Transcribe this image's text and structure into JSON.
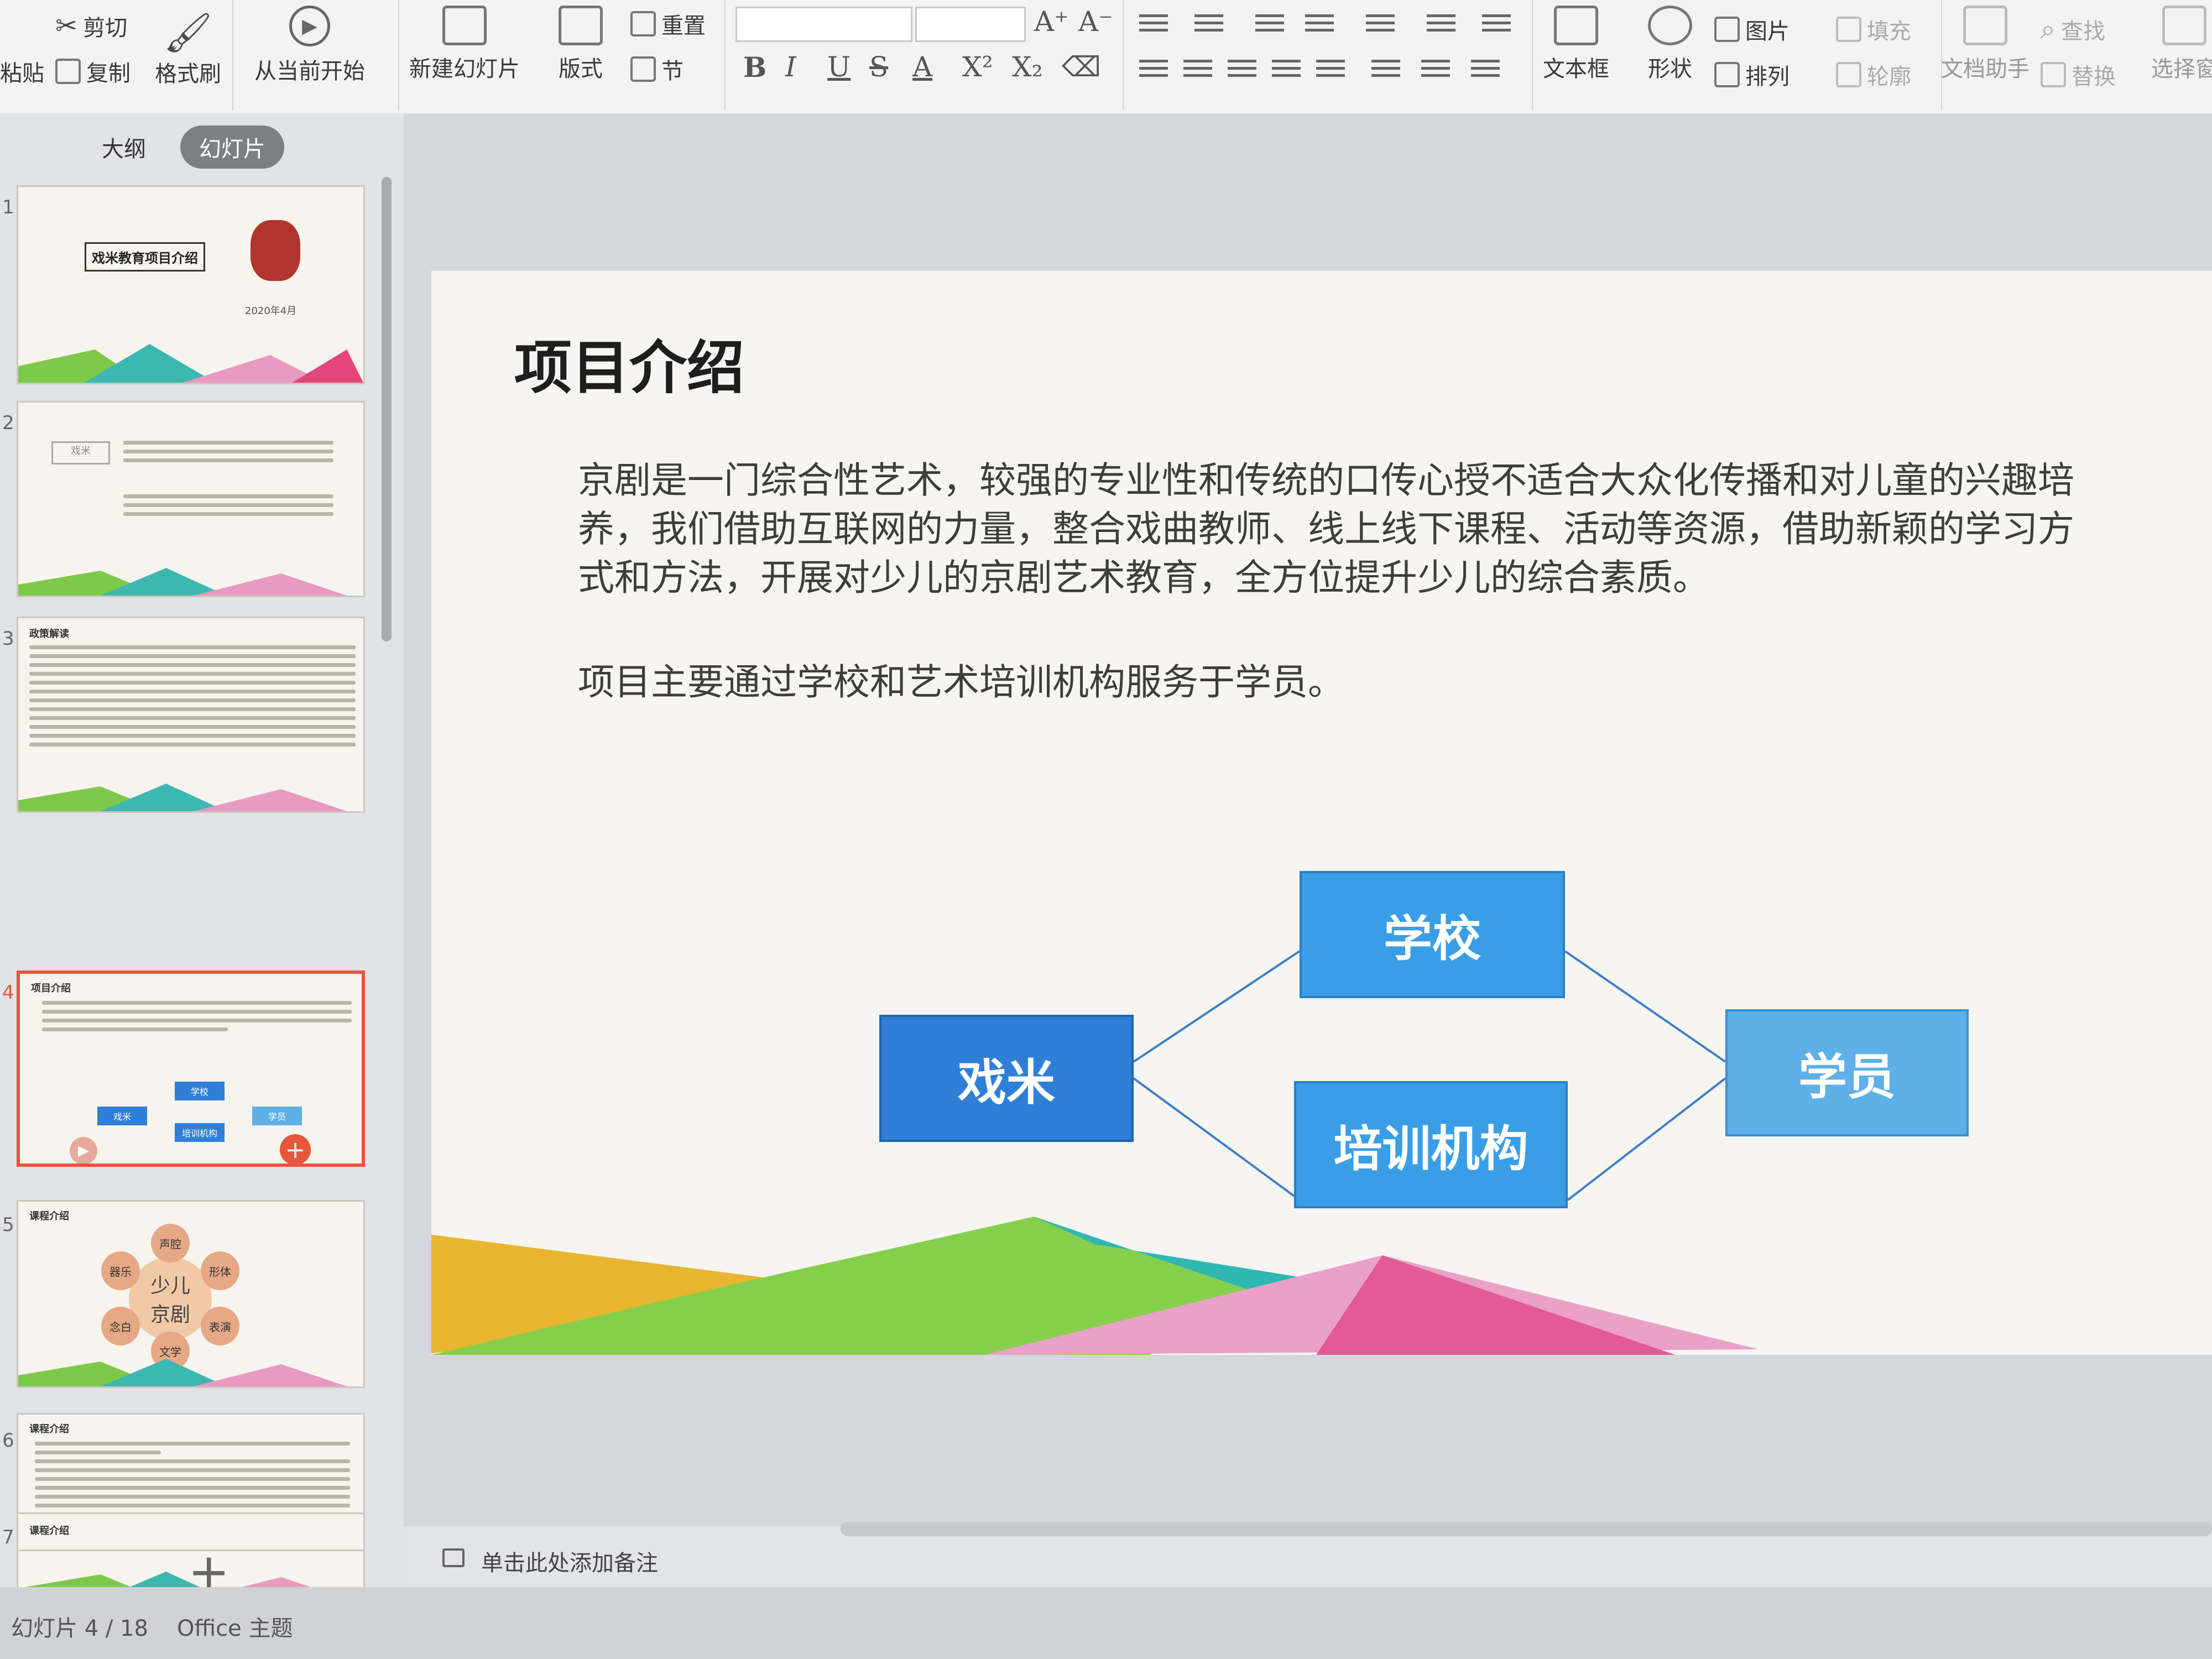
{
  "ribbon": {
    "clipboard": {
      "paste": "粘贴",
      "cut": "剪切",
      "copy": "复制",
      "format_painter": "格式刷"
    },
    "slideshow": {
      "from_current": "从当前开始"
    },
    "slides": {
      "new_slide": "新建幻灯片",
      "layout": "版式",
      "reset": "重置",
      "section": "节"
    },
    "font": {
      "bold": "B",
      "italic": "I",
      "underline": "U",
      "strike": "S",
      "color": "A",
      "superscript": "X²",
      "subscript": "X₂",
      "grow": "A⁺",
      "shrink": "A⁻"
    },
    "drawing": {
      "textbox": "文本框",
      "shape": "形状",
      "picture": "图片",
      "arrange": "排列",
      "fill": "填充",
      "outline": "轮廓"
    },
    "tools": {
      "doc_assistant": "文档助手",
      "find": "查找",
      "replace": "替换",
      "select": "选择窗"
    }
  },
  "left_panel": {
    "tab_outline": "大纲",
    "tab_slides": "幻灯片",
    "thumbs": [
      {
        "num": "1",
        "title": "戏米教育项目介绍",
        "date": "2020年4月"
      },
      {
        "num": "2",
        "title": "戏米"
      },
      {
        "num": "3",
        "title": "政策解读"
      },
      {
        "num": "4",
        "title": "项目介绍",
        "b1": "学校",
        "b2": "戏米",
        "b3": "培训机构",
        "b4": "学员"
      },
      {
        "num": "5",
        "title": "课程介绍",
        "center1": "少儿",
        "center2": "京剧",
        "p1": "声腔",
        "p2": "形体",
        "p3": "表演",
        "p4": "文学",
        "p5": "念白",
        "p6": "器乐"
      },
      {
        "num": "6",
        "title": "课程介绍"
      },
      {
        "num": "7",
        "title": "课程介绍"
      }
    ]
  },
  "slide": {
    "title": "项目介绍",
    "para1_line1": "京剧是一门综合性艺术，较强的专业性和传统的口传心授不适合大众化传播和对儿童的兴趣培",
    "para1_line2": "养，我们借助互联网的力量，整合戏曲教师、线上线下课程、活动等资源，借助新颖的学习方",
    "para1_line3": "式和方法，开展对少儿的京剧艺术教育，全方位提升少儿的综合素质。",
    "para2": "项目主要通过学校和艺术培训机构服务于学员。",
    "diagram": {
      "source": "戏米",
      "top": "学校",
      "bottom": "培训机构",
      "target": "学员"
    }
  },
  "notes": {
    "placeholder": "单击此处添加备注"
  },
  "status": {
    "slide_counter": "幻灯片 4 / 18",
    "theme": "Office 主题"
  },
  "colors": {
    "box_dark": "#2f7fd8",
    "box_mid": "#3a9ee6",
    "box_light": "#5eb0e6",
    "accent_selected": "#e8553d"
  }
}
